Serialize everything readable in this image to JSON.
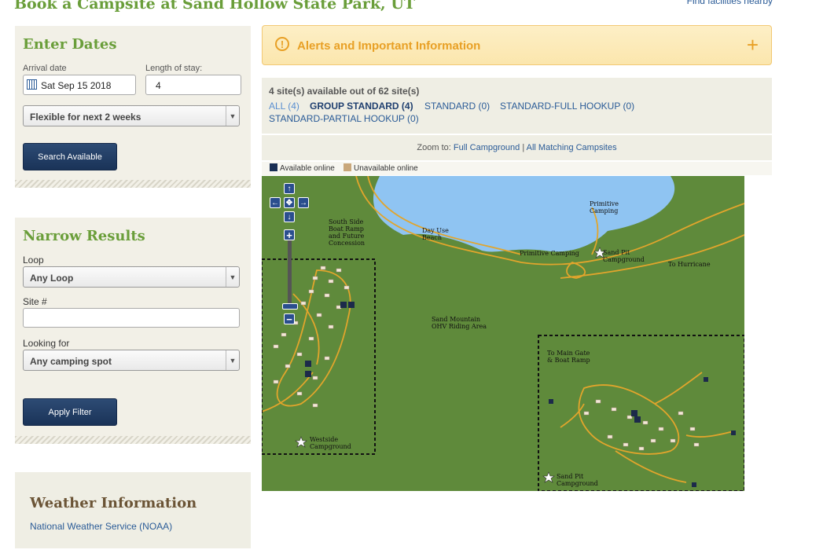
{
  "page": {
    "title": "Book a Campsite at Sand Hollow State Park, UT",
    "find_link": "Find facilities nearby"
  },
  "dates": {
    "heading": "Enter Dates",
    "arrival_label": "Arrival date",
    "arrival_value": "Sat Sep 15 2018",
    "length_label": "Length of stay:",
    "length_value": "4",
    "flex_value": "Flexible for next 2 weeks",
    "search_button": "Search Available"
  },
  "narrow": {
    "heading": "Narrow Results",
    "loop_label": "Loop",
    "loop_value": "Any Loop",
    "site_label": "Site #",
    "site_value": "",
    "looking_label": "Looking for",
    "looking_value": "Any camping spot",
    "apply_button": "Apply Filter"
  },
  "weather": {
    "heading": "Weather Information",
    "link": "National Weather Service (NOAA)"
  },
  "alert": {
    "title": "Alerts and Important Information",
    "icon": "exclamation-icon",
    "toggle": "+"
  },
  "sites": {
    "count_text": "4 site(s) available out of 62 site(s)",
    "filters": [
      "ALL (4)",
      "GROUP STANDARD (4)",
      "STANDARD (0)",
      "STANDARD-FULL HOOKUP (0)",
      "STANDARD-PARTIAL HOOKUP (0)"
    ]
  },
  "zoom": {
    "prefix": "Zoom to:",
    "full": "Full Campground",
    "separator": "|",
    "matching": "All Matching Campsites"
  },
  "legend": {
    "available": "Available online",
    "unavailable": "Unavailable online",
    "available_color": "#1a2f55",
    "unavailable_color": "#c9a77a"
  },
  "map": {
    "labels": {
      "south_side": "South Side\nBoat Ramp\nand Future\nConcession",
      "day_use": "Day Use\nBeach",
      "primitive_top": "Primitive\nCamping",
      "primitive_mid": "Primitive Camping",
      "sand_pit_top": "Sand Pit\nCampground",
      "to_hurricane": "To Hurricane",
      "ohv": "Sand Mountain\nOHV Riding Area",
      "main_gate": "To Main Gate\n& Boat Ramp",
      "westside": "Westside\nCampground",
      "sand_pit_bottom": "Sand Pit\nCampground"
    },
    "colors": {
      "ground": "#5f8a3b",
      "water": "#8fc4f2",
      "road": "#e2a52c"
    }
  }
}
